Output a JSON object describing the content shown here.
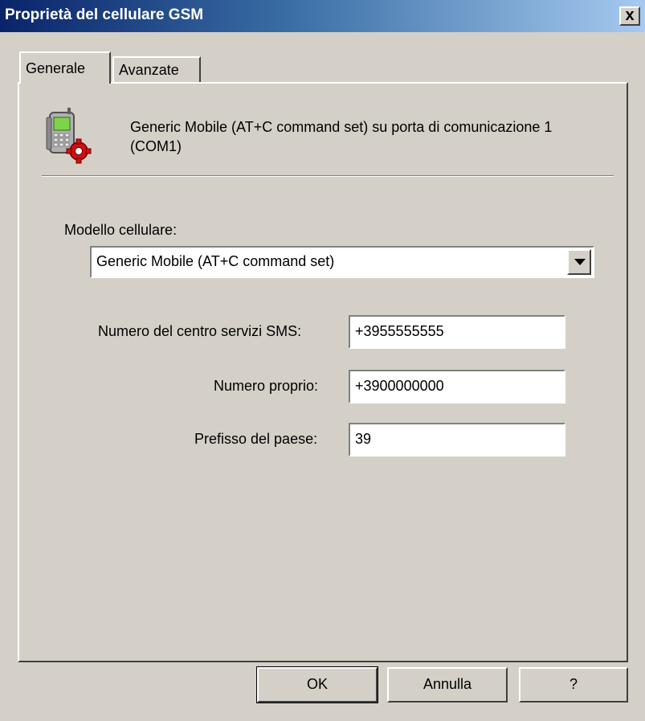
{
  "window": {
    "title": "Proprietà del cellulare GSM",
    "close_label": "x"
  },
  "tabs": [
    {
      "label": "Generale",
      "active": true
    },
    {
      "label": "Avanzate",
      "active": false
    }
  ],
  "device": {
    "icon": "mobile-phone-gear-icon",
    "description": "Generic Mobile (AT+C command set) su porta di comunicazione 1 (COM1)"
  },
  "model": {
    "label": "Modello cellulare:",
    "selected": "Generic Mobile (AT+C command set)"
  },
  "fields": {
    "sms_center": {
      "label": "Numero del centro servizi SMS:",
      "value": "+3955555555"
    },
    "own_number": {
      "label": "Numero proprio:",
      "value": "+3900000000"
    },
    "country_prefix": {
      "label": "Prefisso del paese:",
      "value": "39"
    }
  },
  "buttons": {
    "ok": "OK",
    "cancel": "Annulla",
    "help": "?"
  },
  "colors": {
    "titlebar_start": "#0a246a",
    "titlebar_end": "#a6caf0",
    "face": "#d4d0c8"
  }
}
